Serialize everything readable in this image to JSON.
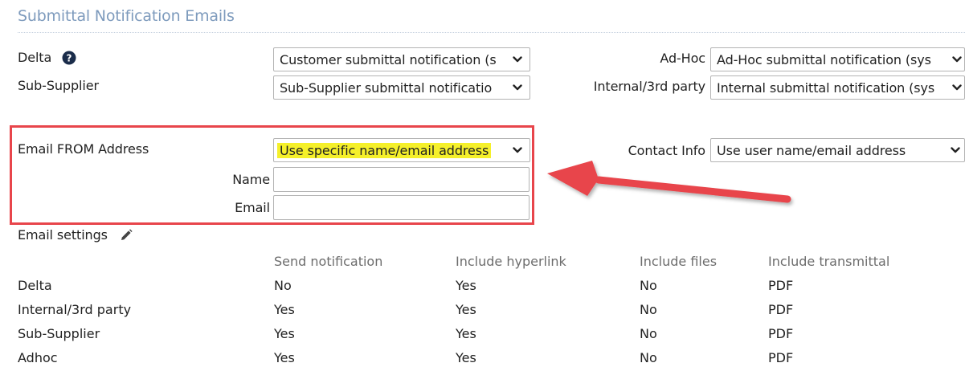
{
  "section": {
    "title": "Submittal Notification Emails"
  },
  "templates": {
    "delta": {
      "label": "Delta",
      "value": "Customer submittal notification (s"
    },
    "sub_supplier": {
      "label": "Sub-Supplier",
      "value": "Sub-Supplier submittal notificatio"
    },
    "ad_hoc": {
      "label": "Ad-Hoc",
      "value": "Ad-Hoc submittal notification (sys"
    },
    "internal": {
      "label": "Internal/3rd party",
      "value": "Internal submittal notification (sys"
    }
  },
  "from_address": {
    "label": "Email FROM Address",
    "value": "Use specific name/email address",
    "name_label": "Name",
    "name_value": "",
    "email_label": "Email",
    "email_value": ""
  },
  "contact_info": {
    "label": "Contact Info",
    "value": "Use user name/email address"
  },
  "email_settings": {
    "label": "Email settings",
    "columns": [
      "Send notification",
      "Include hyperlink",
      "Include files",
      "Include transmittal"
    ],
    "rows": [
      {
        "name": "Delta",
        "values": [
          "No",
          "Yes",
          "No",
          "PDF"
        ]
      },
      {
        "name": "Internal/3rd party",
        "values": [
          "Yes",
          "Yes",
          "No",
          "PDF"
        ]
      },
      {
        "name": "Sub-Supplier",
        "values": [
          "Yes",
          "Yes",
          "No",
          "PDF"
        ]
      },
      {
        "name": "Adhoc",
        "values": [
          "Yes",
          "Yes",
          "No",
          "PDF"
        ]
      }
    ]
  },
  "icons": {
    "help": "question-circle-icon",
    "edit": "pencil-icon",
    "dropdown": "chevron-down-icon",
    "annotation": "red-arrow-annotation"
  },
  "colors": {
    "section_title": "#7e9bbd",
    "highlight": "#f5f02a",
    "annotation_red": "#e8454b",
    "header_text": "#6d6d6d"
  }
}
